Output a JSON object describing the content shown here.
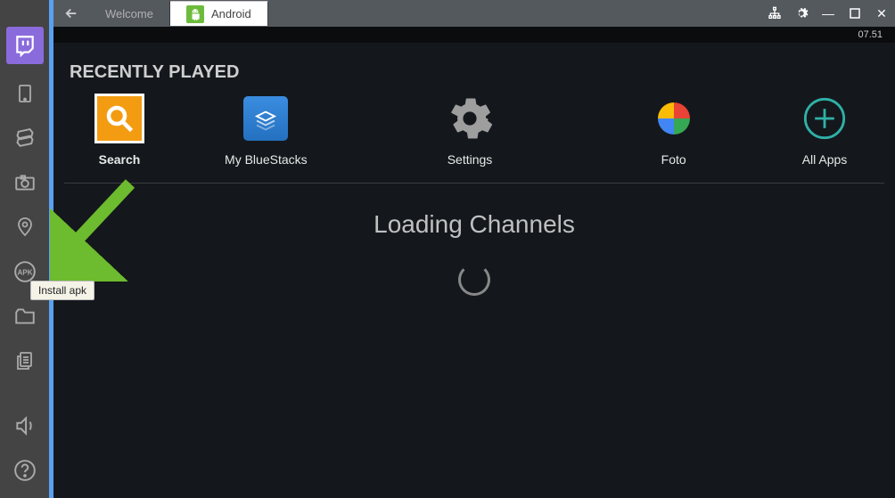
{
  "titlebar": {
    "back": "←",
    "tabs": [
      {
        "label": "Welcome",
        "active": false
      },
      {
        "label": "Android",
        "active": true
      }
    ],
    "controls": {
      "network": "⊞",
      "settings": "⚙",
      "minimize": "—",
      "maximize": "☐",
      "close": "✕"
    }
  },
  "time": "07.51",
  "section": {
    "title": "RECENTLY PLAYED"
  },
  "apps": [
    {
      "label": "Search",
      "icon": "search"
    },
    {
      "label": "My BlueStacks",
      "icon": "bluestacks"
    },
    {
      "label": "Settings",
      "icon": "gear"
    },
    {
      "label": "Foto",
      "icon": "photos"
    },
    {
      "label": "All Apps",
      "icon": "plus"
    }
  ],
  "loading": {
    "text": "Loading Channels"
  },
  "sidebar": {
    "twitch": "twitch",
    "tooltip": "Install apk"
  }
}
